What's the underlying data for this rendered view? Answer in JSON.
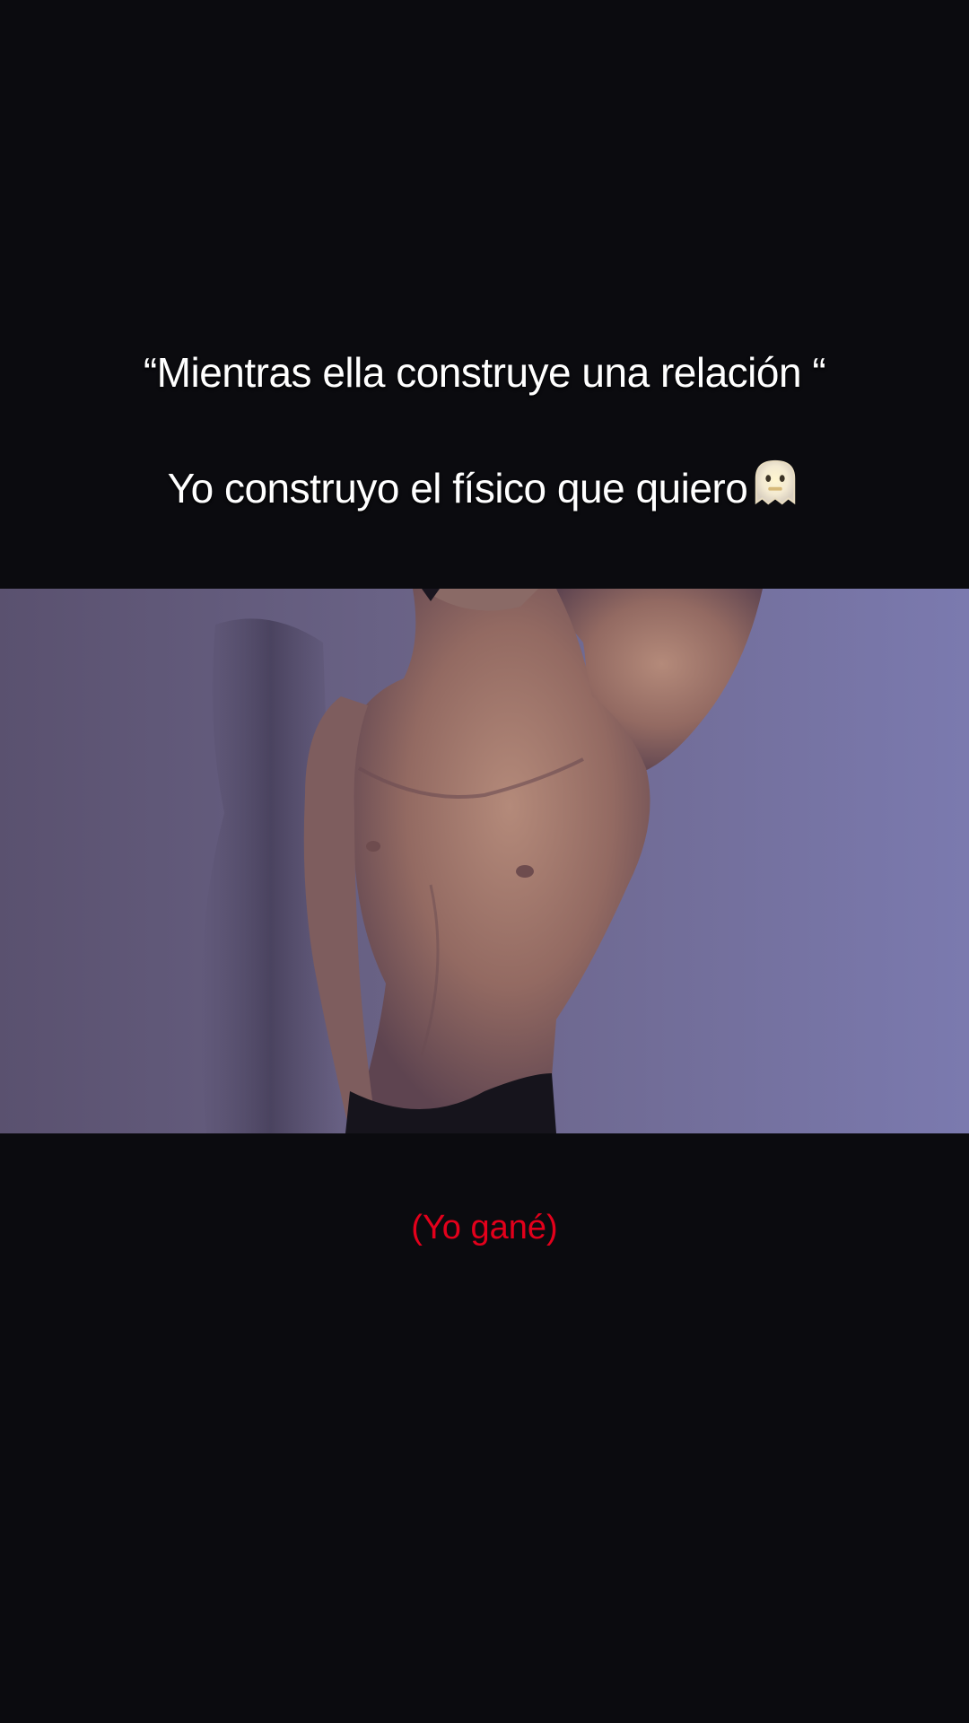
{
  "caption": {
    "line1": "“Mientras ella construye una relación “",
    "line2": "Yo construyo el físico que quiero"
  },
  "emoji_icon": "ghost-face-emoji-icon",
  "video": {
    "subject": "shirtless torso photo"
  },
  "tagline": "(Yo gané)",
  "colors": {
    "background": "#0b0b0f",
    "caption_text": "#ffffff",
    "tagline_text": "#e3001b",
    "wall": "#6e6a94"
  }
}
